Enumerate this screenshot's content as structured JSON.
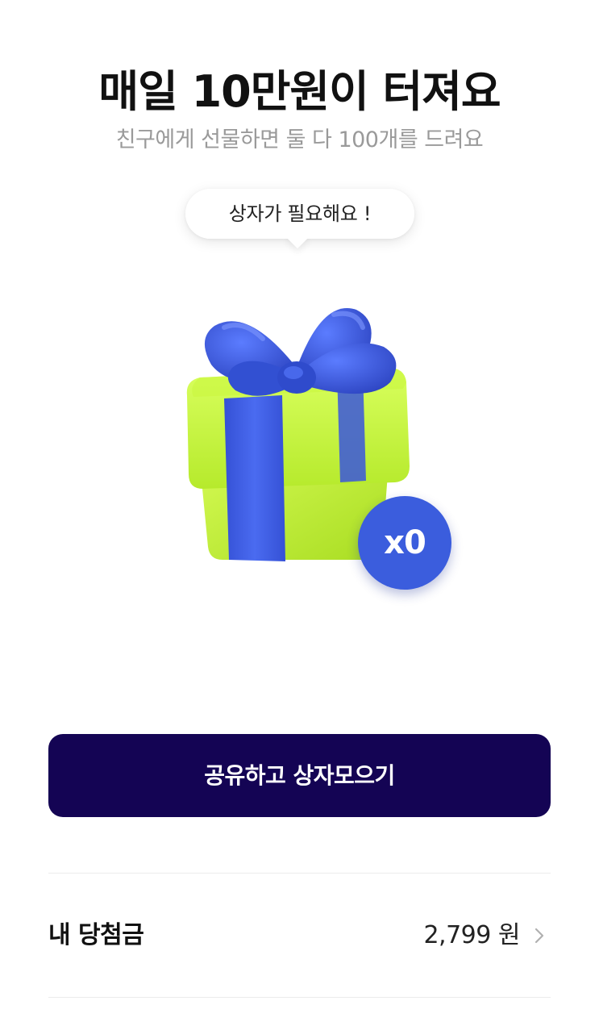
{
  "header": {
    "title": "매일 10만원이 터져요",
    "subtitle": "친구에게 선물하면 둘 다 100개를 드려요"
  },
  "tooltip": {
    "text": "상자가 필요해요 !"
  },
  "gift": {
    "icon": "gift-box-icon",
    "count_label": "x0",
    "box_color": "#c5f33c",
    "ribbon_color": "#3f5fe0",
    "badge_color": "#3b5ddd"
  },
  "cta": {
    "label": "공유하고 상자모으기",
    "background": "#140454"
  },
  "winnings": {
    "label": "내 당첨금",
    "value": "2,799 원",
    "icon": "chevron-right-icon"
  }
}
